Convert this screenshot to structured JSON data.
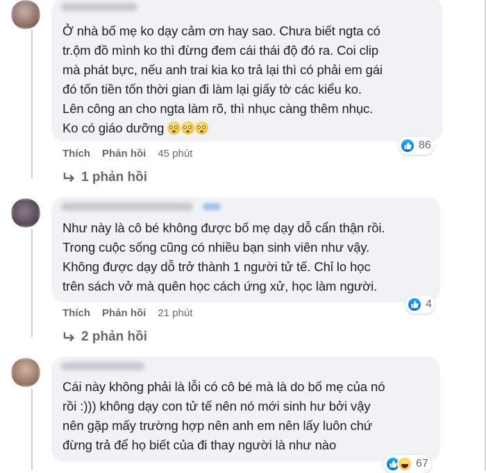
{
  "comments": [
    {
      "text_lines": [
        "Ở nhà bố mẹ ko dạy cảm ơn hay sao. Chưa biết ngta có",
        "tr.ộm đồ mình ko thì đừng đem cái thái độ đó ra. Coi clip",
        "mà phát bực, nếu anh trai kia ko trả lại thì có phải em gái",
        "đó tốn tiền tốn thời gian đi làm lại giấy tờ các kiểu ko.",
        "Lên công an cho ngta làm rõ, thì nhục càng thêm nhục.",
        "Ko có giáo dưỡng"
      ],
      "emoji": [
        "rolling-eyes-emoji",
        "rolling-eyes-emoji",
        "rolling-eyes-emoji"
      ],
      "reaction_count": "86",
      "reactions": [
        "like"
      ],
      "like_label": "Thích",
      "reply_label": "Phản hồi",
      "time": "45 phút",
      "replies_label": "1 phản hồi"
    },
    {
      "text_lines": [
        "Như này là cô bé không được bố mẹ dạy dỗ cẩn thận rồi.",
        "Trong cuộc sống cũng có nhiều bạn sinh viên như vậy.",
        "Không được dạy dỗ trở thành 1 người tử tế. Chỉ lo học",
        "trên sách vở mà quên học cách ứng xử, học làm người."
      ],
      "reaction_count": "4",
      "reactions": [
        "like"
      ],
      "like_label": "Thích",
      "reply_label": "Phản hồi",
      "time": "21 phút",
      "replies_label": "2 phản hồi"
    },
    {
      "text_lines": [
        "Cái này không phải là lỗi có cô bé mà là do bố mẹ của nó",
        "rồi :))) không dạy con tử tế nên nó mới sinh hư bởi vậy",
        "nên gặp mấy trường hợp nên anh em nên lấy luôn chứ",
        "đừng trả để họ biết của đi thay người là như nào"
      ],
      "reaction_count": "67",
      "reactions": [
        "like",
        "haha"
      ]
    }
  ],
  "colors": {
    "bubble": "#f0f2f5",
    "meta_text": "#65676b",
    "like_blue": "#1877f2"
  }
}
